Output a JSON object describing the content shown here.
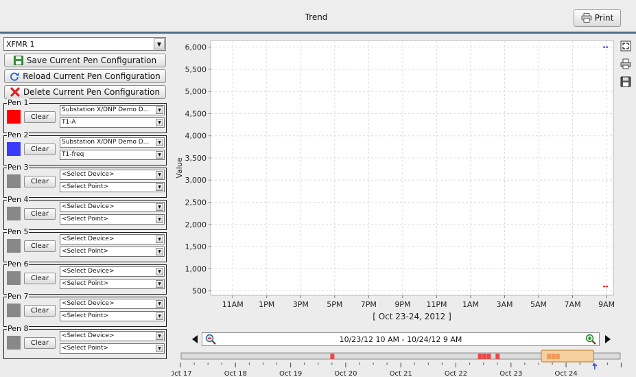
{
  "header": {
    "title": "Trend",
    "print_label": "Print"
  },
  "device_select": {
    "value": "XFMR 1"
  },
  "config_buttons": {
    "save": "Save Current Pen Configuration",
    "reload": "Reload Current Pen Configuration",
    "delete": "Delete Current Pen Configuration"
  },
  "pens": [
    {
      "label": "Pen 1",
      "color": "#ff0000",
      "clear": "Clear",
      "device": "Substation X/DNP Demo D...",
      "point": "T1-A"
    },
    {
      "label": "Pen 2",
      "color": "#3a3aff",
      "clear": "Clear",
      "device": "Substation X/DNP Demo D...",
      "point": "T1-freq"
    },
    {
      "label": "Pen 3",
      "color": "#888888",
      "clear": "Clear",
      "device": "<Select Device>",
      "point": "<Select Point>"
    },
    {
      "label": "Pen 4",
      "color": "#888888",
      "clear": "Clear",
      "device": "<Select Device>",
      "point": "<Select Point>"
    },
    {
      "label": "Pen 5",
      "color": "#888888",
      "clear": "Clear",
      "device": "<Select Device>",
      "point": "<Select Point>"
    },
    {
      "label": "Pen 6",
      "color": "#888888",
      "clear": "Clear",
      "device": "<Select Device>",
      "point": "<Select Point>"
    },
    {
      "label": "Pen 7",
      "color": "#888888",
      "clear": "Clear",
      "device": "<Select Device>",
      "point": "<Select Point>"
    },
    {
      "label": "Pen 8",
      "color": "#888888",
      "clear": "Clear",
      "device": "<Select Device>",
      "point": "<Select Point>"
    }
  ],
  "chart_data": {
    "type": "line",
    "ylabel": "Value",
    "xlabel": "[ Oct 23-24, 2012 ]",
    "ylim": [
      400,
      6150
    ],
    "yticks": [
      500,
      1000,
      1500,
      2000,
      2500,
      3000,
      3500,
      4000,
      4500,
      5000,
      5500,
      6000
    ],
    "ytick_labels": [
      "500",
      "1,000",
      "1,500",
      "2,000",
      "2,500",
      "3,000",
      "3,500",
      "4,000",
      "4,500",
      "5,000",
      "5,500",
      "6,000"
    ],
    "xlim": [
      -1.3,
      22.4
    ],
    "xticks": [
      0,
      2,
      4,
      6,
      8,
      10,
      12,
      14,
      16,
      18,
      20,
      22
    ],
    "xtick_labels": [
      "11AM",
      "1PM",
      "3PM",
      "5PM",
      "7PM",
      "9PM",
      "11PM",
      "1AM",
      "3AM",
      "5AM",
      "7AM",
      "9AM"
    ],
    "grid": true,
    "series": [
      {
        "color": "#ff0000",
        "x": [
          21.8,
          22.1
        ],
        "y": [
          600,
          600
        ]
      },
      {
        "color": "#3a3aff",
        "x": [
          21.8,
          22.1
        ],
        "y": [
          6000,
          6000
        ]
      }
    ]
  },
  "range": {
    "text": "10/23/12 10 AM - 10/24/12 9 AM"
  },
  "timeline": {
    "day_labels": [
      "Oct 17",
      "Oct 18",
      "Oct 19",
      "Oct 20",
      "Oct 21",
      "Oct 22",
      "Oct 23",
      "Oct 24"
    ],
    "event_color": "#e84a4a",
    "events": [
      2.72,
      5.4,
      5.48,
      5.56,
      5.72
    ],
    "window_start": 6.55,
    "window_end": 7.5,
    "window_events": [
      6.65,
      6.73,
      6.81
    ]
  },
  "icons": {
    "print": "printer-icon",
    "save": "disk-icon",
    "reload": "refresh-icon",
    "delete": "red-x-icon",
    "fit": "fit-view-icon",
    "side_print": "printer-icon",
    "side_save": "disk-icon",
    "zoom_out": "zoom-out-icon",
    "zoom_in": "zoom-in-icon"
  }
}
